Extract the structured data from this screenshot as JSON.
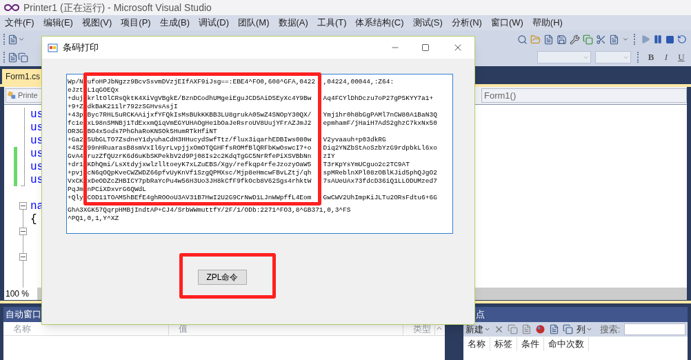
{
  "window": {
    "title": "Printer1 (正在运行) - Microsoft Visual Studio"
  },
  "menu": [
    "文件(F)",
    "编辑(E)",
    "视图(V)",
    "项目(P)",
    "生成(B)",
    "调试(D)",
    "团队(M)",
    "数据(A)",
    "工具(T)",
    "体系结构(C)",
    "测试(S)",
    "分析(N)",
    "窗口(W)",
    "帮助(H)"
  ],
  "format_buttons": [
    "B",
    "I",
    "U"
  ],
  "document_tab": {
    "label": "Form1.cs",
    "selected": true
  },
  "nav": {
    "type_combo": "Printe",
    "member_combo": "Form1()"
  },
  "code_lines": [
    {
      "text": "us",
      "changed": false
    },
    {
      "text": "us",
      "changed": false
    },
    {
      "text": "us",
      "changed": false
    },
    {
      "text": "us",
      "changed": true
    },
    {
      "text": "us",
      "changed": true
    },
    {
      "text": "us",
      "changed": true
    },
    {
      "changed": false
    },
    {
      "text": "na",
      "changed": false
    },
    {
      "text": "{",
      "changed": false
    }
  ],
  "zoom": "100 %",
  "dialog": {
    "title": "条码打印",
    "text_lines": [
      {
        "left": "Wp/N",
        "middle": "ufoHPJbNgzz9BcvSsvmDVzjEIfAXF9iJsg==:EBE4^FO0,608^GFA,0422",
        "right": ",04224,00044,:Z64:"
      },
      {
        "left": "eJzt",
        "middle": "L1qGOEQx"
      },
      {
        "left": "+duj",
        "middle": "krltOlCRsQktK4XiVgVBgkE/BznDCodhUMgeiEguJCD5AiD5EyXc4Y9Bw",
        "right": "Aq4FCYlDhDczu7oP27gP5KYY7a1+"
      },
      {
        "left": "+9+Z",
        "middle": "dkBaK211lr792zSGHvsAsjI"
      },
      {
        "left": "+43p",
        "middle": "Byc7RHL5uRCKAAijxfYFQkIsMsBUkKKBB3LU8grukA05wZ4SNOpY30QX/",
        "right": "Ymj1hr0h8bGgPAMl7nCW80A1BaN3Q"
      },
      {
        "left": "fc1e",
        "middle": "xL98nSMNBj1TdExxmQiqVmEGYUHAOgHe1bOaJeRsroUV8UujYFrAZJmJ2",
        "right": "epmhamF/jHaiH7AdS2ghzC7kxNx50"
      },
      {
        "left": "OR3G",
        "middle": "BO4x5ods7PhGhaRoKNSOk5HumRTkHfiNT"
      },
      {
        "left": "+Ga2",
        "middle": "5UbGLTO7ZsdneY1dyuhaCdH3HHucydSwfTtz/flux3iqarhEDBIws080w",
        "right": "V2yvaauh+p03dkRG"
      },
      {
        "left": "+4SZ",
        "middle": "99nHRuarasB8smVxIl6yrLvpjjxOmOTQGHFfsROMfBlQRFbKwOswcI7+o",
        "right": "Diq2YNZbStAoSzbYzG9rdpbkLl6xo"
      },
      {
        "left": "GvA4",
        "middle": "ruzZfQUzrK6d6uKbSKPekbV2d9Pj08Is2c2KdqTgGC5NrRfePiXSVBbNn",
        "right": "zIY"
      },
      {
        "left": "+dr1",
        "middle": "KDhQmi/LsXtdyjxwlzlltoeyK7xLZuEBS/Xgy/refkqp4rfeJzozyOaW5",
        "right": "T3rKpYsYmUCguo2c2TC9AT"
      },
      {
        "left": "+pvj",
        "middle": "cN6qOQpKveCWZWDZ66pfvUyKnVf1SzgQPMXsc/Mjp8eHmcwFBvLZtj/qh",
        "right": "spMReblnXPl08zOBlKJid5phQJgO2"
      },
      {
        "left": "VxCK",
        "middle": "xDeODZcZHBICY7pbRaYcPu4w56H3Uo3JH8kCfF9fkOcb8V62Sgs4rhktW",
        "right": "7sAUeUAx73fdcD36iQ1LLODUMzed7"
      },
      {
        "left": "PqJm",
        "middle": "nPCiXDxvrG6QWdL"
      },
      {
        "left": "+Qly",
        "middle": "COD11TOAM5hBEfE4ghROOoU3AV31B7HwI2U2G9CrNwD1LJnWWpffL4Eom",
        "right": "GwCWV2UhImpKiJLTu2ORsFdtu6+6G"
      },
      {
        "text": "GhA3XGK57QqrpHMBjIndtAP+CJ4/SrbWWmuttfY/2F/1/ODb:2271^FO3,8^GB371,0,3^FS"
      },
      {
        "text": "^PQ1,0,1,Y^XZ"
      }
    ],
    "text_highlighted": true,
    "button": "ZPL命令",
    "button_highlighted": true
  },
  "autos_pane": {
    "title": "自动窗口",
    "columns": [
      "名称",
      "值",
      "类型"
    ]
  },
  "breakpoints_pane": {
    "title": "点",
    "new_button": "新建",
    "columns_button": "列",
    "search_label": "搜索:",
    "columns": [
      "名称",
      "标签",
      "条件",
      "命中次数"
    ]
  }
}
